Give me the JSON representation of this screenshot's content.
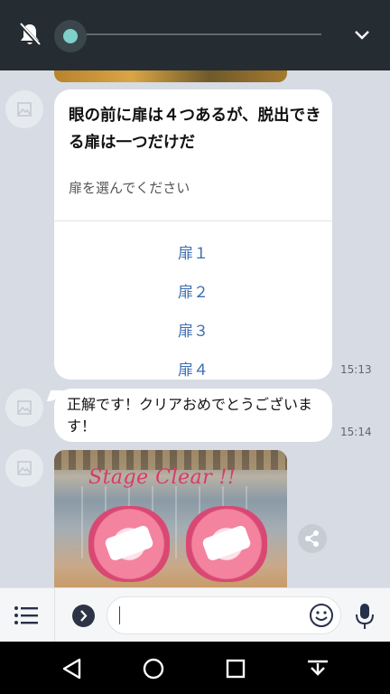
{
  "card": {
    "title": "眼の前に扉は４つあるが、脱出できる扉は一つだけだ",
    "subtitle": "扉を選んでください",
    "options": [
      "扉１",
      "扉２",
      "扉３",
      "扉４"
    ],
    "time": "15:13"
  },
  "reply": {
    "text": "正解です！クリアおめでとうございます！",
    "time": "15:14"
  },
  "photo": {
    "caption": "Stage Clear !!"
  },
  "input": {
    "value": ""
  },
  "icons": {
    "mute": "bell-off-icon",
    "collapse": "chevron-down-icon",
    "menu": "menu-list-icon",
    "expand": "chevron-right-icon",
    "emoji": "smiley-icon",
    "mic": "microphone-icon",
    "share": "share-icon",
    "back": "nav-back-icon",
    "home": "nav-home-icon",
    "recents": "nav-recents-icon",
    "keyboard": "nav-hide-keyboard-icon"
  },
  "colors": {
    "accent_link": "#3d6db1",
    "audio_dot": "#7ed0c8",
    "topbar": "#252d33",
    "chat_bg": "#d7dce4"
  }
}
